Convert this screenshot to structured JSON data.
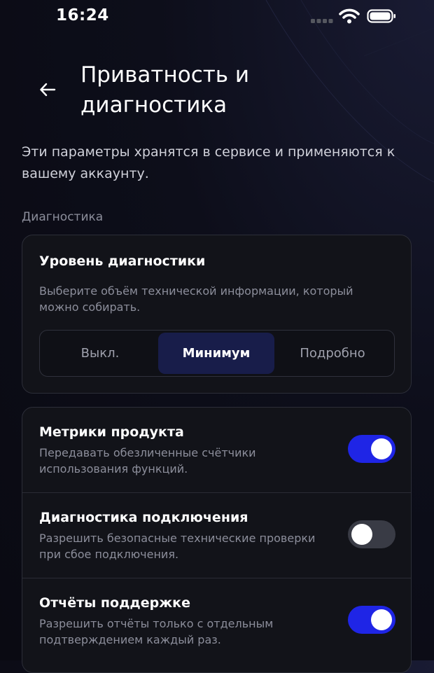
{
  "status_bar": {
    "time": "16:24"
  },
  "header": {
    "title": "Приватность и диагностика",
    "description": "Эти параметры хранятся в сервисе и применяются к вашему аккаунту."
  },
  "section_label": "Диагностика",
  "diagnostic_level": {
    "title": "Уровень диагностики",
    "subtitle": "Выберите объём технической информации, который можно собирать.",
    "options": [
      "Выкл.",
      "Минимум",
      "Подробно"
    ],
    "selected": "Минимум"
  },
  "toggles": [
    {
      "title": "Метрики продукта",
      "description": "Передавать обезличенные счётчики использования функций.",
      "enabled": true
    },
    {
      "title": "Диагностика подключения",
      "description": "Разрешить безопасные технические проверки при сбое подключения.",
      "enabled": false
    },
    {
      "title": "Отчёты поддержке",
      "description": "Разрешить отчёты только с отдельным подтверждением каждый раз.",
      "enabled": true
    }
  ],
  "colors": {
    "accent": "#1f25e6",
    "selected_segment": "#181d4a",
    "background": "#0c0d16"
  }
}
